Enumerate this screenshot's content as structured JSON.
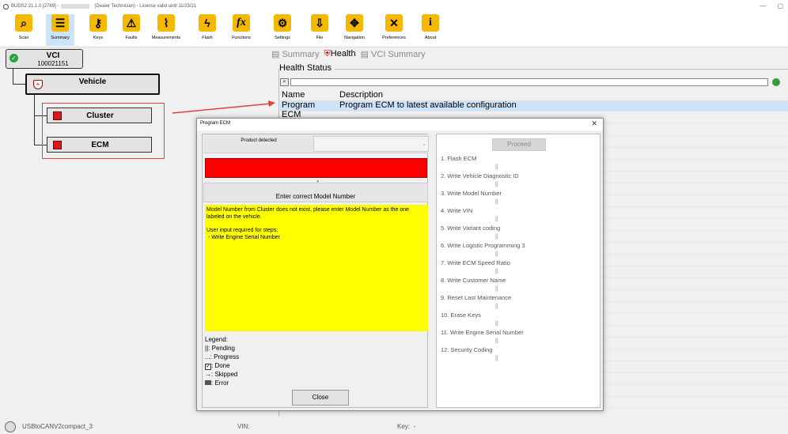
{
  "window": {
    "title_prefix": "BUDS2 21.1.0 [2769] - ",
    "title_suffix": " (Dealer Technician) - License valid until 11/23/21",
    "controls": [
      "—",
      "▢"
    ]
  },
  "toolbar": {
    "left_buttons": [
      {
        "label": "Scan",
        "icon": "scan-icon",
        "color": "#f5b800",
        "glyph": "⌕"
      },
      {
        "label": "Summary",
        "icon": "summary-icon",
        "color": "#f5b800",
        "glyph": "☰"
      },
      {
        "label": "Keys",
        "icon": "keys-icon",
        "color": "#f5b800",
        "glyph": "⚷"
      },
      {
        "label": "Faults",
        "icon": "faults-icon",
        "color": "#f5b800",
        "glyph": "⚠"
      },
      {
        "label": "Measurements",
        "icon": "measurements-icon",
        "color": "#f5b800",
        "glyph": "⌇"
      },
      {
        "label": "Flash",
        "icon": "flash-icon",
        "color": "#f5b800",
        "glyph": "ϟ"
      },
      {
        "label": "Functions",
        "icon": "functions-icon",
        "color": "#f5b800",
        "glyph": "fx"
      }
    ],
    "right_buttons": [
      {
        "label": "Settings",
        "icon": "settings-icon",
        "color": "#f5b800",
        "glyph": "⚙"
      },
      {
        "label": "File",
        "icon": "file-icon",
        "color": "#f5b800",
        "glyph": "⇩"
      },
      {
        "label": "Navigation",
        "icon": "navigation-icon",
        "color": "#f5b800",
        "glyph": "✥"
      },
      {
        "label": "Preferences",
        "icon": "preferences-icon",
        "color": "#f5b800",
        "glyph": "✕"
      },
      {
        "label": "About",
        "icon": "about-icon",
        "color": "#f5b800",
        "glyph": "i"
      }
    ]
  },
  "tree": {
    "vci_name": "VCI",
    "vci_id": "100021151",
    "vehicle": "Vehicle",
    "cluster": "Cluster",
    "ecm": "ECM"
  },
  "tabs": {
    "summary": "Summary",
    "health": "Health",
    "vci_summary": "VCI Summary"
  },
  "health": {
    "title": "Health Status",
    "col_name": "Name",
    "col_description": "Description",
    "row_name": "Program ECM",
    "row_description": "Program ECM to latest available configuration"
  },
  "dialog": {
    "title": "Program ECM",
    "close_glyph": "✕",
    "product_detected": "Product detected",
    "enter_model": "Enter correct Model Number",
    "message_1": "Model Number from Cluster does not exist, please enter Model Number as the one labeled on the vehicle.",
    "message_2": "User input required for steps:",
    "message_3": " - Write Engine Serial Number",
    "legend_title": "Legend:",
    "legend_pending": "||: Pending",
    "legend_progress": "...: Progress",
    "legend_done": ": Done",
    "legend_skipped": "→: Skipped",
    "legend_error": ": Error",
    "close_button": "Close",
    "proceed_button": "Proceed",
    "steps": [
      "1. Flash ECM",
      "2. Write Vehicle Diagnostic ID",
      "3. Write Model Number",
      "4. Write VIN",
      "5. Write Variant coding",
      "6. Write Logistic Programming 3",
      "7. Write ECM Speed Ratio",
      "8. Write Customer Name",
      "9. Reset Last Maintenance",
      "10. Erase Keys",
      "11. Write Engine Serial Number",
      "12. Security Coding"
    ],
    "pending_mark": "||"
  },
  "statusbar": {
    "device": "USBtoCANV2compact_3",
    "vin_label": "VIN:",
    "key_label": "Key:  -"
  },
  "colors": {
    "error_red": "#ff0000",
    "warning_yellow": "#ffff00",
    "selection_blue": "#cfe3f6",
    "highlight_red": "#e04040"
  }
}
